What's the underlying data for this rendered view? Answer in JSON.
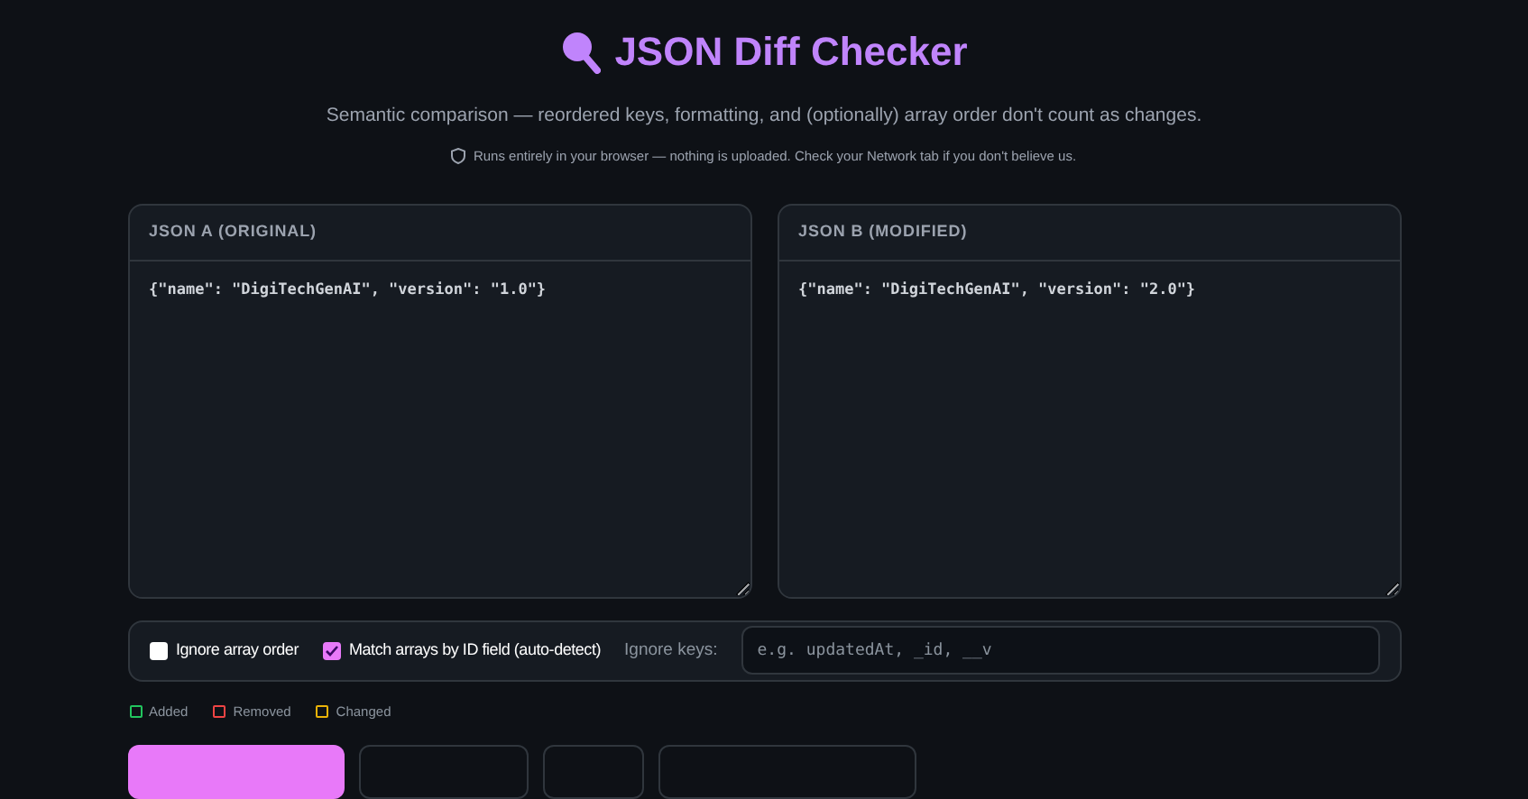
{
  "title": "JSON Diff Checker",
  "subtitle": "Semantic comparison — reordered keys, formatting, and (optionally) array order don't count as changes.",
  "privacy_note": "Runs entirely in your browser — nothing is uploaded. Check your Network tab if you don't believe us.",
  "editors": [
    {
      "label": "JSON A (ORIGINAL)",
      "value": "{\"name\": \"DigiTechGenAI\", \"version\": \"1.0\"}"
    },
    {
      "label": "JSON B (MODIFIED)",
      "value": "{\"name\": \"DigiTechGenAI\", \"version\": \"2.0\"}"
    }
  ],
  "options": [
    {
      "label": "Ignore array order",
      "checked": false
    },
    {
      "label": "Match arrays by ID field (auto-detect)",
      "checked": true
    }
  ],
  "ignore_keys": {
    "label": "Ignore keys:",
    "placeholder": "e.g. updatedAt, _id, __v"
  },
  "legend": [
    {
      "label": "Added",
      "color": "#22c55e"
    },
    {
      "label": "Removed",
      "color": "#ef4444"
    },
    {
      "label": "Changed",
      "color": "#eab308"
    }
  ],
  "buttons": [
    {
      "kind": "primary"
    },
    {
      "kind": "secondary"
    },
    {
      "kind": "secondary"
    },
    {
      "kind": "secondary"
    }
  ]
}
